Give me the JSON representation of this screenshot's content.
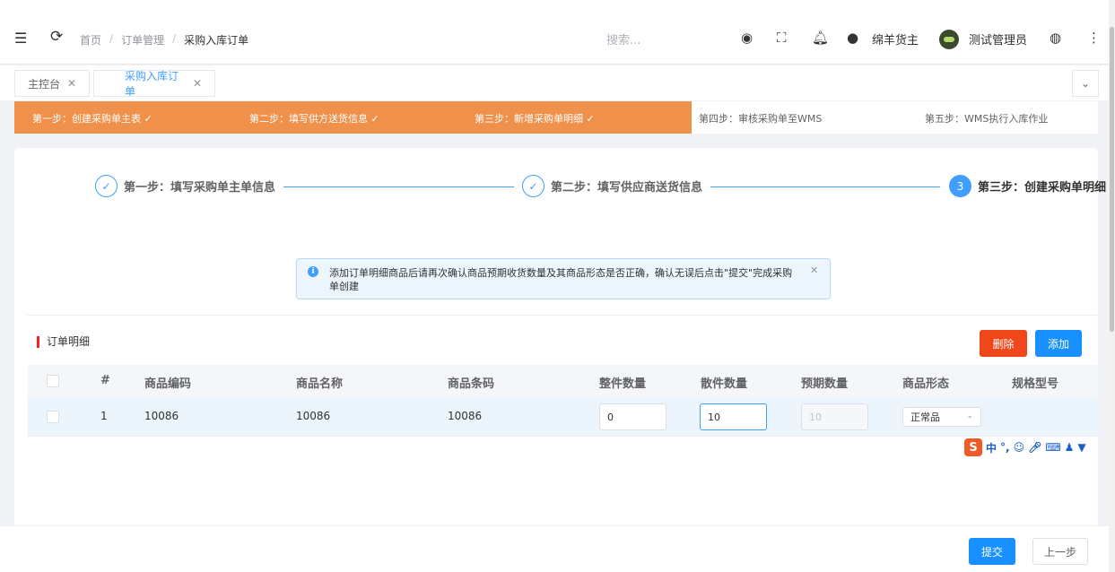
{
  "header": {
    "breadcrumbs": [
      "首页",
      "订单管理",
      "采购入库订单"
    ],
    "search_placeholder": "搜索...",
    "owner": "绵羊货主",
    "user": "测试管理员"
  },
  "tags": [
    {
      "label": "主控台"
    },
    {
      "label": "采购入库订单"
    }
  ],
  "process_steps": [
    {
      "label": "第一步：创建采购单主表 ✓",
      "done": true
    },
    {
      "label": "第二步：填写供方送货信息 ✓",
      "done": true
    },
    {
      "label": "第三步：新增采购单明细 ✓",
      "done": true
    },
    {
      "label": "第四步：审核采购单至WMS",
      "done": false
    },
    {
      "label": "第五步：WMS执行入库作业",
      "done": false
    }
  ],
  "wizard": {
    "steps": [
      {
        "icon": "✓",
        "title": "第一步：填写采购单主单信息"
      },
      {
        "icon": "✓",
        "title": "第二步：填写供应商送货信息"
      },
      {
        "icon": "3",
        "title": "第三步：创建采购单明细"
      }
    ]
  },
  "alert": {
    "text": "添加订单明细商品后请再次确认商品预期收货数量及其商品形态是否正确，确认无误后点击\"提交\"完成采购单创建"
  },
  "section": {
    "title": "订单明细",
    "delete_label": "删除",
    "add_label": "添加"
  },
  "table": {
    "columns": [
      "#",
      "商品编码",
      "商品名称",
      "商品条码",
      "整件数量",
      "散件数量",
      "预期数量",
      "商品形态",
      "规格型号"
    ],
    "rows": [
      {
        "index": "1",
        "code": "10086",
        "name": "10086",
        "barcode": "10086",
        "whole_qty": "0",
        "loose_qty": "10",
        "expected_qty": "10",
        "form": "正常品",
        "spec": ""
      }
    ]
  },
  "ime": {
    "label": "中"
  },
  "footer": {
    "submit_label": "提交",
    "prev_label": "上一步"
  },
  "colors": {
    "primary": "#1890ff",
    "danger": "#f0471a",
    "process_done": "#f0914b"
  }
}
